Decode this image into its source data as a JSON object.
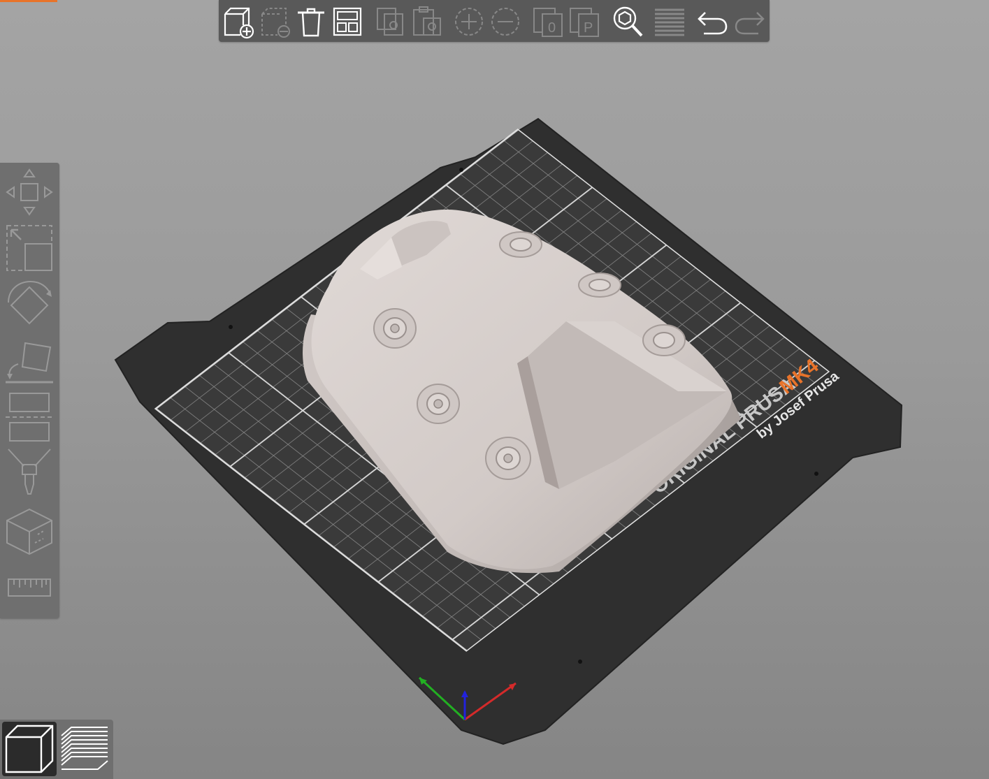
{
  "app": {
    "accent_color": "#e8732a"
  },
  "top_toolbar": {
    "buttons": [
      {
        "name": "add-object",
        "icon": "cube-plus-icon",
        "enabled": true
      },
      {
        "name": "delete",
        "icon": "cube-minus-icon",
        "enabled": false
      },
      {
        "name": "delete-all",
        "icon": "trash-icon",
        "enabled": true
      },
      {
        "name": "arrange",
        "icon": "arrange-icon",
        "enabled": true
      },
      {
        "name": "copy",
        "icon": "copy-icon",
        "enabled": false
      },
      {
        "name": "paste",
        "icon": "paste-icon",
        "enabled": false
      },
      {
        "name": "add-instance",
        "icon": "plus-circle-icon",
        "enabled": false
      },
      {
        "name": "remove-instance",
        "icon": "minus-circle-icon",
        "enabled": false
      },
      {
        "name": "split-to-objects",
        "icon": "split-objects-icon",
        "enabled": false
      },
      {
        "name": "split-to-parts",
        "icon": "split-parts-icon",
        "enabled": false
      },
      {
        "name": "search",
        "icon": "search-icon",
        "enabled": true
      },
      {
        "name": "layer-editing",
        "icon": "layers-icon",
        "enabled": false
      },
      {
        "name": "undo",
        "icon": "undo-icon",
        "enabled": true
      },
      {
        "name": "redo",
        "icon": "redo-icon",
        "enabled": false
      }
    ]
  },
  "left_toolbar": {
    "tools": [
      {
        "name": "move",
        "icon": "move-icon"
      },
      {
        "name": "scale",
        "icon": "scale-icon"
      },
      {
        "name": "rotate",
        "icon": "rotate-icon"
      },
      {
        "name": "place-on-face",
        "icon": "place-on-face-icon"
      },
      {
        "name": "cut",
        "icon": "cut-icon"
      },
      {
        "name": "paint",
        "icon": "paint-icon"
      },
      {
        "name": "seam",
        "icon": "seam-cube-icon"
      },
      {
        "name": "measure",
        "icon": "ruler-icon"
      }
    ]
  },
  "view_toolbar": {
    "buttons": [
      {
        "name": "3d-view",
        "icon": "cube-view-icon",
        "active": true
      },
      {
        "name": "preview",
        "icon": "layers-preview-icon",
        "active": false
      }
    ]
  },
  "bed": {
    "label_line1": "ORIGINAL PRUSA",
    "label_model": "MK4",
    "label_line2": "by Josef Prusa"
  },
  "axes": {
    "x_color": "#d42a2a",
    "y_color": "#22b022",
    "z_color": "#2222dd"
  }
}
